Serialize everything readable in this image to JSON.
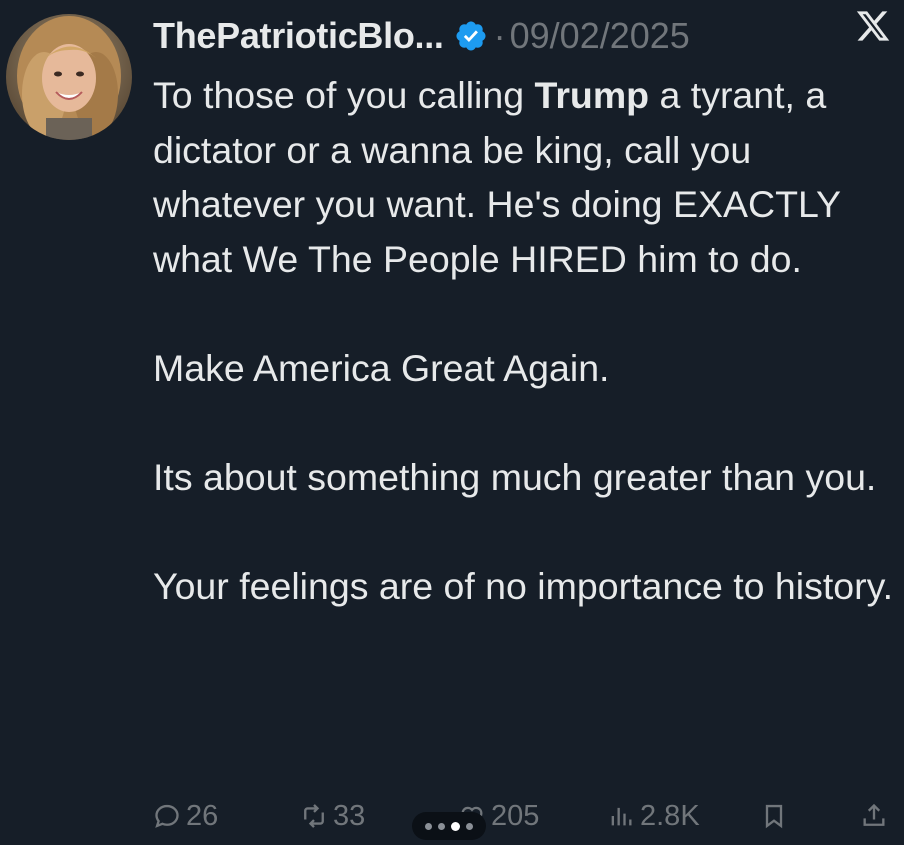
{
  "tweet": {
    "display_name": "ThePatrioticBlo...",
    "separator": "·",
    "date": "09/02/2025",
    "paragraphs": {
      "p1_pre": "To those of you calling ",
      "p1_bold": "Trump",
      "p1_post": " a tyrant, a dictator or a wanna be king, call you whatever you want. He's doing EXACTLY what We The People HIRED him to do.",
      "p2": "Make America Great Again.",
      "p3": "Its about something much greater than you.",
      "p4": "Your feelings are of no importance to history."
    }
  },
  "actions": {
    "replies": "26",
    "reposts": "33",
    "likes": "205",
    "views": "2.8K"
  },
  "icons": {
    "verified": "verified-badge-icon",
    "x_logo": "x-logo-icon",
    "reply": "reply-icon",
    "repost": "repost-icon",
    "like": "heart-icon",
    "views": "views-icon",
    "bookmark": "bookmark-icon",
    "share": "share-icon"
  },
  "colors": {
    "background": "#161e28",
    "text": "#e7e9ea",
    "muted": "#71767b",
    "verified": "#1d9bf0"
  },
  "carousel": {
    "pages": 4,
    "active": 3
  }
}
